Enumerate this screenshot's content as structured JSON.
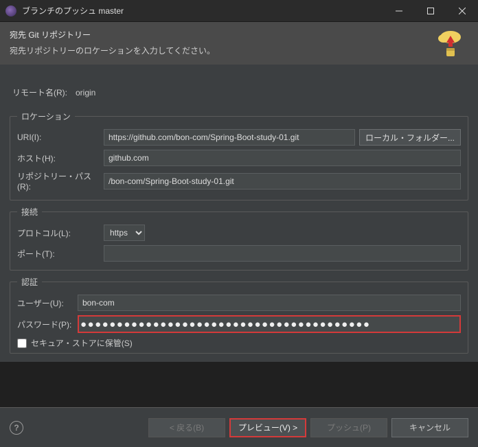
{
  "window": {
    "title": "ブランチのプッシュ master"
  },
  "header": {
    "title": "宛先 Git リポジトリー",
    "subtitle": "宛先リポジトリーのロケーションを入力してください。"
  },
  "remote": {
    "label": "リモート名(R):",
    "value": "origin"
  },
  "location": {
    "legend": "ロケーション",
    "uri_label": "URI(I):",
    "uri_value": "https://github.com/bon-com/Spring-Boot-study-01.git",
    "local_button": "ローカル・フォルダー...",
    "host_label": "ホスト(H):",
    "host_value": "github.com",
    "repo_label": "リポジトリー・パス(R):",
    "repo_value": "/bon-com/Spring-Boot-study-01.git"
  },
  "connection": {
    "legend": "接続",
    "protocol_label": "プロトコル(L):",
    "protocol_value": "https",
    "port_label": "ポート(T):",
    "port_value": ""
  },
  "auth": {
    "legend": "認証",
    "user_label": "ユーザー(U):",
    "user_value": "bon-com",
    "password_label": "パスワード(P):",
    "password_masked": "●●●●●●●●●●●●●●●●●●●●●●●●●●●●●●●●●●●●●●●●",
    "store_label": "セキュア・ストアに保管(S)",
    "store_checked": false
  },
  "footer": {
    "back": "< 戻る(B)",
    "preview": "プレビュー(V) >",
    "push": "プッシュ(P)",
    "cancel": "キャンセル"
  }
}
